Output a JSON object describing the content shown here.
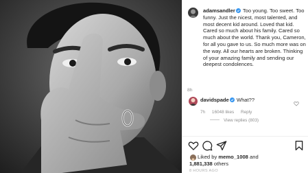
{
  "post": {
    "image_alt": "Black and white portrait photo"
  },
  "caption": {
    "username": "adamsandler",
    "text": "Too young. Too sweet. Too funny. Just the nicest, most talented, and most decent kid around. Loved that kid. Cared so much about his family. Cared so much about the world. Thank you, Cameron, for all you gave to us. So much more was on the way. All our hearts are broken. Thinking of your amazing family and sending our deepest condolences.",
    "time": "8h"
  },
  "reply": {
    "username": "davidspade",
    "text": "What??",
    "time": "7h",
    "likes": "16048 likes",
    "reply_label": "Reply",
    "view_replies": "View replies (803)"
  },
  "likes": {
    "liked_by_prefix": "Liked by ",
    "liked_by_user": "memo_1008",
    "and": " and",
    "others_count": "1,881,338",
    "others_suffix": " others"
  },
  "footer": {
    "ago": "8 HOURS AGO"
  },
  "colors": {
    "verified": "#3897f0",
    "text": "#262626",
    "muted": "#8e8e8e"
  }
}
